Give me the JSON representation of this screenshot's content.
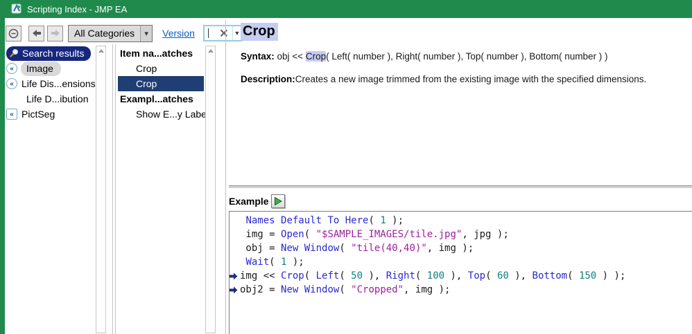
{
  "window": {
    "title": "Scripting Index - JMP EA"
  },
  "toolbar": {
    "category_value": "All Categories",
    "version_link": "Version",
    "search_value": ""
  },
  "left_panel": {
    "items": [
      {
        "label": "Search results",
        "icon": "search-icon",
        "state": "selected"
      },
      {
        "label": "Image",
        "icon": "collapse-chevron-icon",
        "state": "highlighted"
      },
      {
        "label": "Life Dis...ensions",
        "icon": "collapse-chevron-icon",
        "state": "normal"
      },
      {
        "label": "Life D...ibution",
        "icon": "none",
        "state": "normal"
      },
      {
        "label": "PictSeg",
        "icon": "collapse-chevron-square-icon",
        "state": "normal"
      }
    ]
  },
  "middle_panel": {
    "items": [
      {
        "label": "Item na...atches",
        "kind": "header"
      },
      {
        "label": "Crop",
        "kind": "item"
      },
      {
        "label": "Crop",
        "kind": "item",
        "state": "selected"
      },
      {
        "label": "Exampl...atches",
        "kind": "header"
      },
      {
        "label": "Show E...y Label",
        "kind": "item"
      }
    ]
  },
  "detail": {
    "title": "Crop",
    "syntax_label": "Syntax:",
    "syntax_prefix": " obj << ",
    "syntax_match": "Crop",
    "syntax_suffix": "( Left( number ), Right( number ), Top( number ), Bottom( number ) )",
    "description_label": "Description:",
    "description_text": "Creates a new image trimmed from the existing image with the specified dimensions.",
    "example_label": "Example"
  },
  "code": {
    "lines": [
      {
        "marker": false,
        "segments": [
          [
            " ",
            "p"
          ],
          [
            "Names Default To Here",
            "k"
          ],
          [
            "( ",
            "p"
          ],
          [
            "1",
            "n"
          ],
          [
            " );",
            "p"
          ]
        ]
      },
      {
        "marker": false,
        "segments": [
          [
            " img = ",
            "p"
          ],
          [
            "Open",
            "k"
          ],
          [
            "( ",
            "p"
          ],
          [
            "\"$SAMPLE_IMAGES/tile.jpg\"",
            "s"
          ],
          [
            ", jpg );",
            "p"
          ]
        ]
      },
      {
        "marker": false,
        "segments": [
          [
            " obj = ",
            "p"
          ],
          [
            "New Window",
            "k"
          ],
          [
            "( ",
            "p"
          ],
          [
            "\"tile(40,40)\"",
            "s"
          ],
          [
            ", img );",
            "p"
          ]
        ]
      },
      {
        "marker": false,
        "segments": [
          [
            " ",
            "p"
          ],
          [
            "Wait",
            "k"
          ],
          [
            "( ",
            "p"
          ],
          [
            "1",
            "n"
          ],
          [
            " );",
            "p"
          ]
        ]
      },
      {
        "marker": true,
        "segments": [
          [
            "img << ",
            "p"
          ],
          [
            "Crop",
            "k"
          ],
          [
            "( ",
            "p"
          ],
          [
            "Left",
            "k"
          ],
          [
            "( ",
            "p"
          ],
          [
            "50",
            "n"
          ],
          [
            " ), ",
            "p"
          ],
          [
            "Right",
            "k"
          ],
          [
            "( ",
            "p"
          ],
          [
            "100",
            "n"
          ],
          [
            " ), ",
            "p"
          ],
          [
            "Top",
            "k"
          ],
          [
            "( ",
            "p"
          ],
          [
            "60",
            "n"
          ],
          [
            " ), ",
            "p"
          ],
          [
            "Bottom",
            "k"
          ],
          [
            "( ",
            "p"
          ],
          [
            "150",
            "n"
          ],
          [
            " ) );",
            "p"
          ]
        ]
      },
      {
        "marker": true,
        "segments": [
          [
            "obj2 = ",
            "p"
          ],
          [
            "New Window",
            "k"
          ],
          [
            "( ",
            "p"
          ],
          [
            "\"Cropped\"",
            "s"
          ],
          [
            ", img );",
            "p"
          ]
        ]
      }
    ]
  },
  "colors": {
    "titlebar_green": "#1f8a4c",
    "selection_navy": "#1f3e73",
    "search_pill_navy": "#17277e",
    "match_highlight": "#c5cdf1",
    "code_keyword_blue": "#2929cc",
    "code_number_teal": "#0f7f82",
    "code_string_purple": "#9e219e",
    "marker_navy": "#1f2f7f",
    "search_border_blue": "#8ecfe3"
  }
}
